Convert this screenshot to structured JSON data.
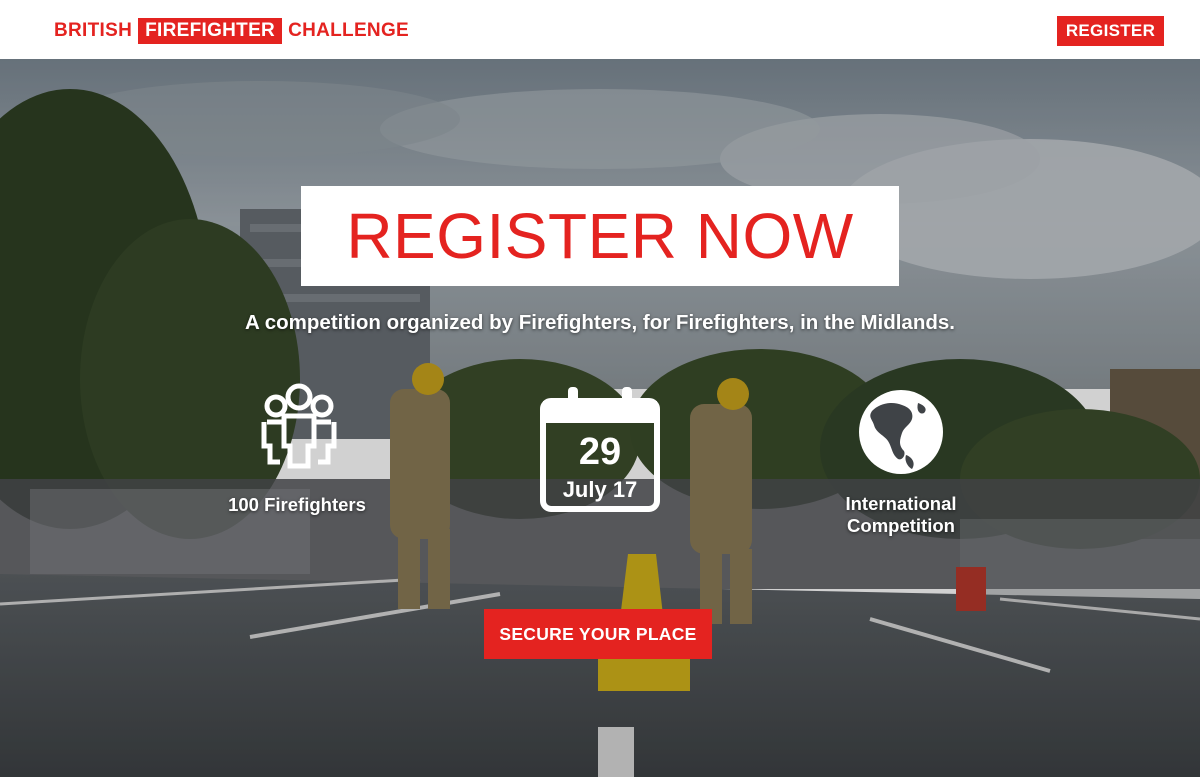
{
  "header": {
    "logo": {
      "part1": "BRITISH",
      "part2": "FIREFIGHTER",
      "part3": "CHALLENGE"
    },
    "register_label": "REGISTER"
  },
  "hero": {
    "title": "REGISTER NOW",
    "subtitle": "A competition organized by Firefighters, for Firefighters, in the Midlands.",
    "features": {
      "firefighters": {
        "icon": "group-people-icon",
        "label": "100 Firefighters"
      },
      "date": {
        "icon": "calendar-icon",
        "day": "29",
        "month": "July 17"
      },
      "international": {
        "icon": "globe-icon",
        "line1": "International",
        "line2": "Competition"
      }
    },
    "cta_label": "SECURE YOUR PLACE"
  },
  "colors": {
    "accent": "#e42320",
    "text_light": "#ffffff"
  }
}
